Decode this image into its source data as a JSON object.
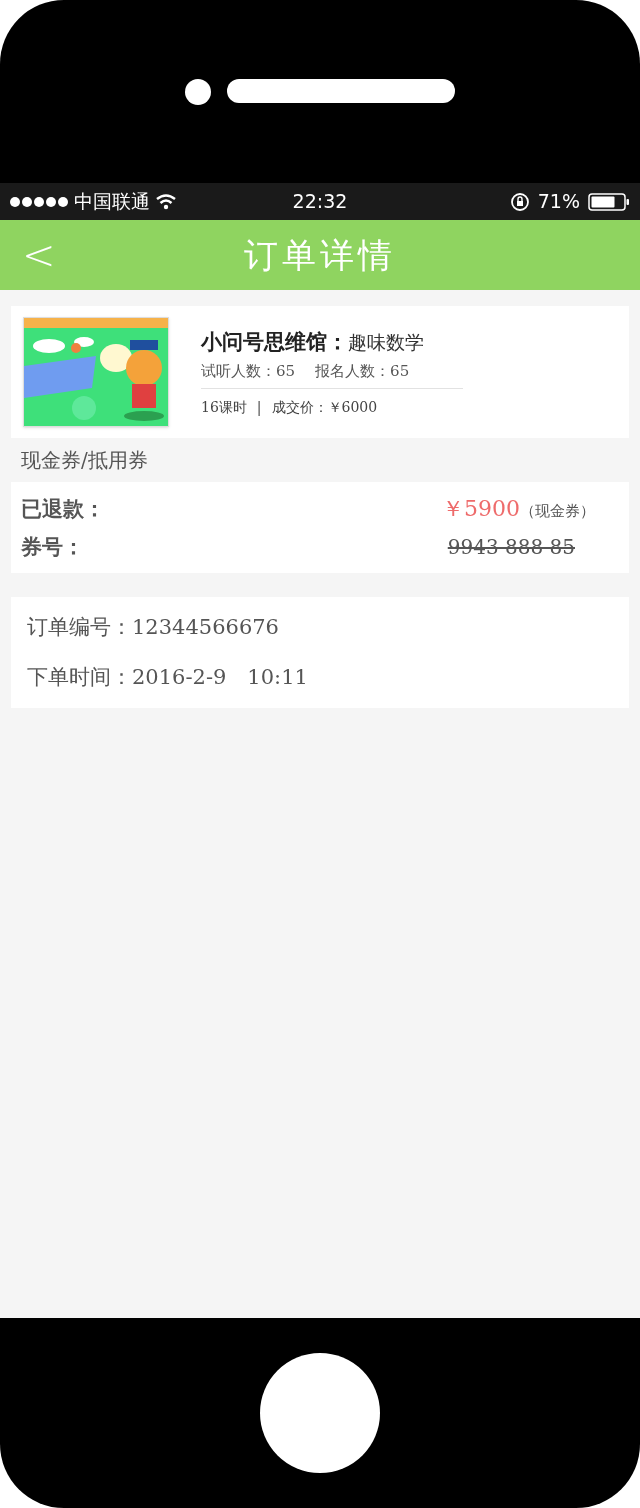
{
  "status_bar": {
    "carrier": "中国联通",
    "time": "22:32",
    "battery": "71%"
  },
  "nav": {
    "back": "<",
    "title": "订单详情"
  },
  "course": {
    "name": "小问号思维馆：",
    "subject": "趣味数学",
    "trial_label": "试听人数：65",
    "signup_label": "报名人数：65",
    "hours": "16课时",
    "separator": "|",
    "price": "成交价：￥6000"
  },
  "voucher_section": {
    "title": "现金券/抵用券",
    "refund_label": "已退款：",
    "refund_amount": "￥5900",
    "refund_type": "（现金券）",
    "code_label": "券号：",
    "code": "9943 888 85",
    "code_void": true
  },
  "order": {
    "number": "订单编号：12344566676",
    "time": "下单时间：2016-2-9　10:11"
  }
}
